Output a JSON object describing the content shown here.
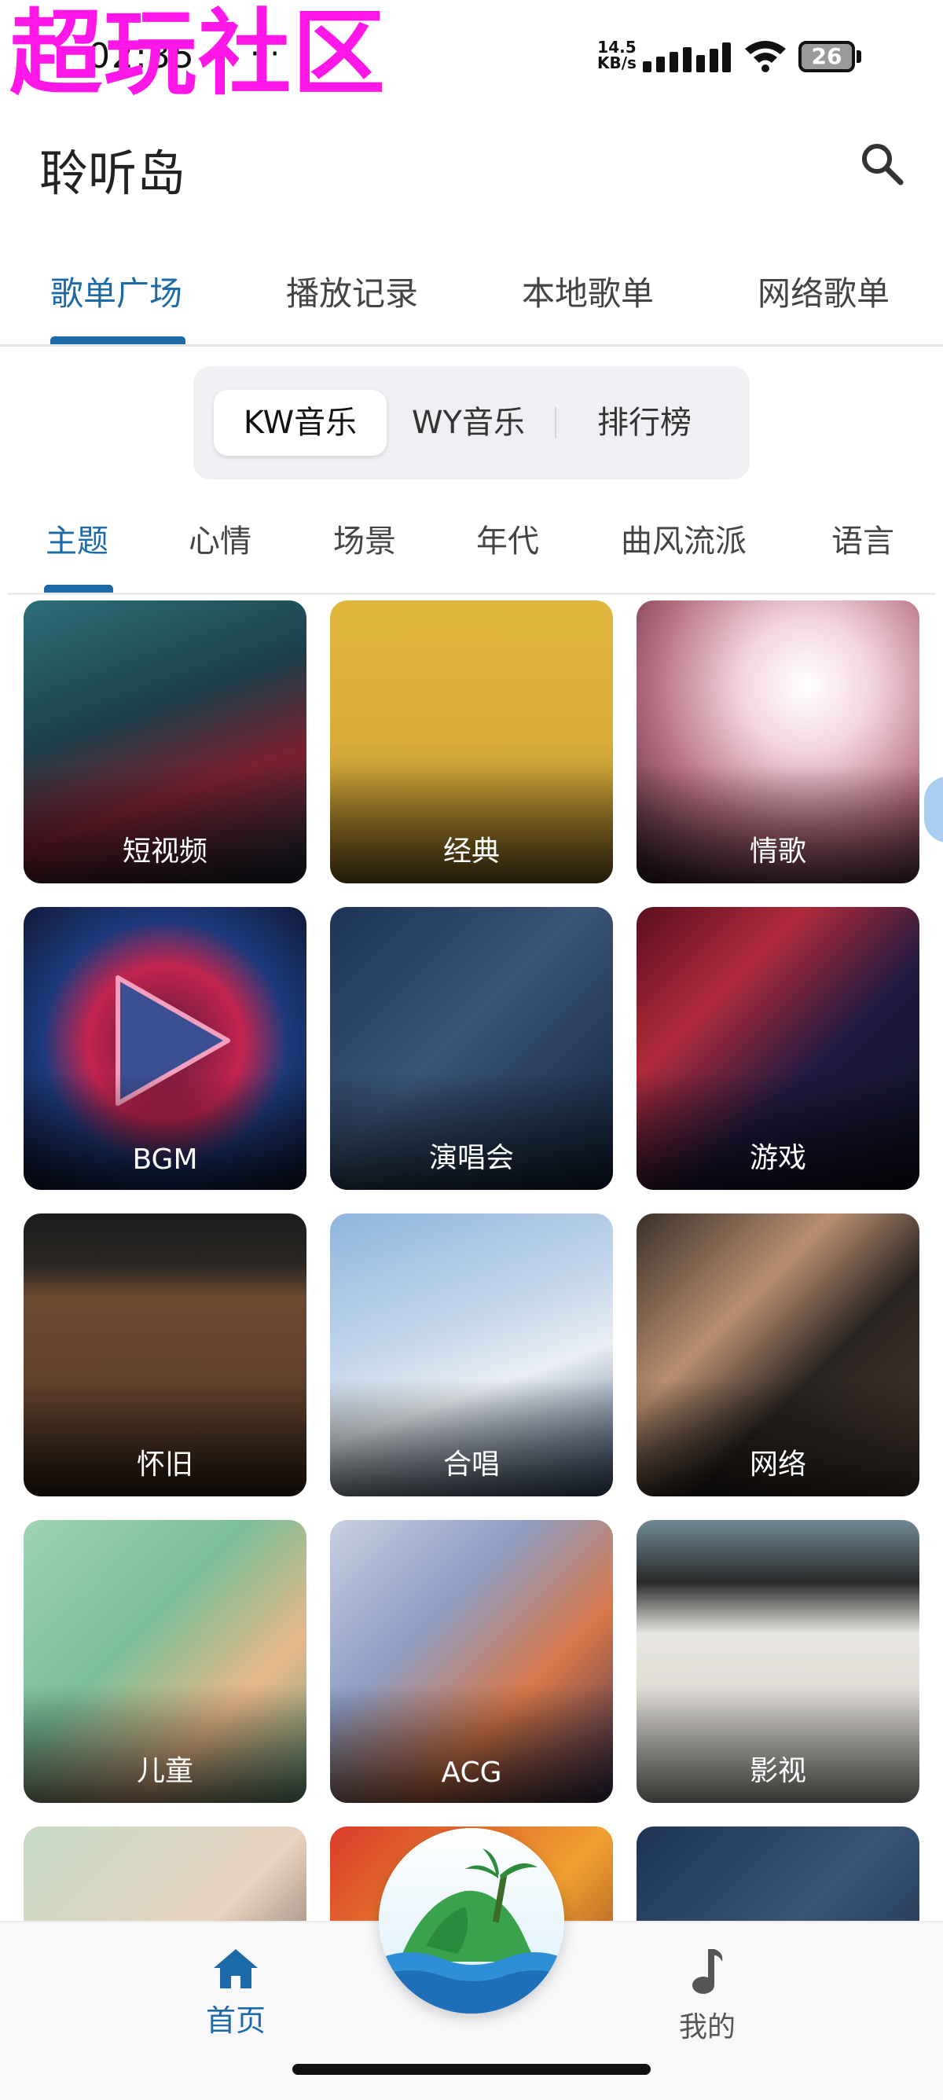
{
  "status_bar": {
    "watermark": "超玩社区",
    "clock": "02:35",
    "more_dots": "···",
    "net_speed_value": "14.5",
    "net_speed_unit": "KB/s",
    "battery": "26"
  },
  "header": {
    "title": "聆听岛",
    "search_icon": "search-icon"
  },
  "top_tabs": {
    "items": [
      "歌单广场",
      "播放记录",
      "本地歌单",
      "网络歌单"
    ],
    "active": "歌单广场"
  },
  "sources": {
    "items": [
      "KW音乐",
      "WY音乐",
      "排行榜"
    ],
    "active": "KW音乐"
  },
  "categories": {
    "items": [
      "主题",
      "心情",
      "场景",
      "年代",
      "曲风流派",
      "语言"
    ],
    "active": "主题"
  },
  "playlists": [
    {
      "label": "短视频"
    },
    {
      "label": "经典"
    },
    {
      "label": "情歌"
    },
    {
      "label": "BGM"
    },
    {
      "label": "演唱会"
    },
    {
      "label": "游戏"
    },
    {
      "label": "怀旧"
    },
    {
      "label": "合唱"
    },
    {
      "label": "网络"
    },
    {
      "label": "儿童"
    },
    {
      "label": "ACG"
    },
    {
      "label": "影视"
    },
    {
      "label": ""
    },
    {
      "label": ""
    },
    {
      "label": ""
    }
  ],
  "bottom_nav": {
    "home": "首页",
    "mine": "我的",
    "home_icon": "home-icon",
    "mine_icon": "music-note-icon",
    "center_icon": "island-logo-icon"
  },
  "colors": {
    "accent": "#1c6aa8",
    "watermark": "#ff17e8"
  }
}
